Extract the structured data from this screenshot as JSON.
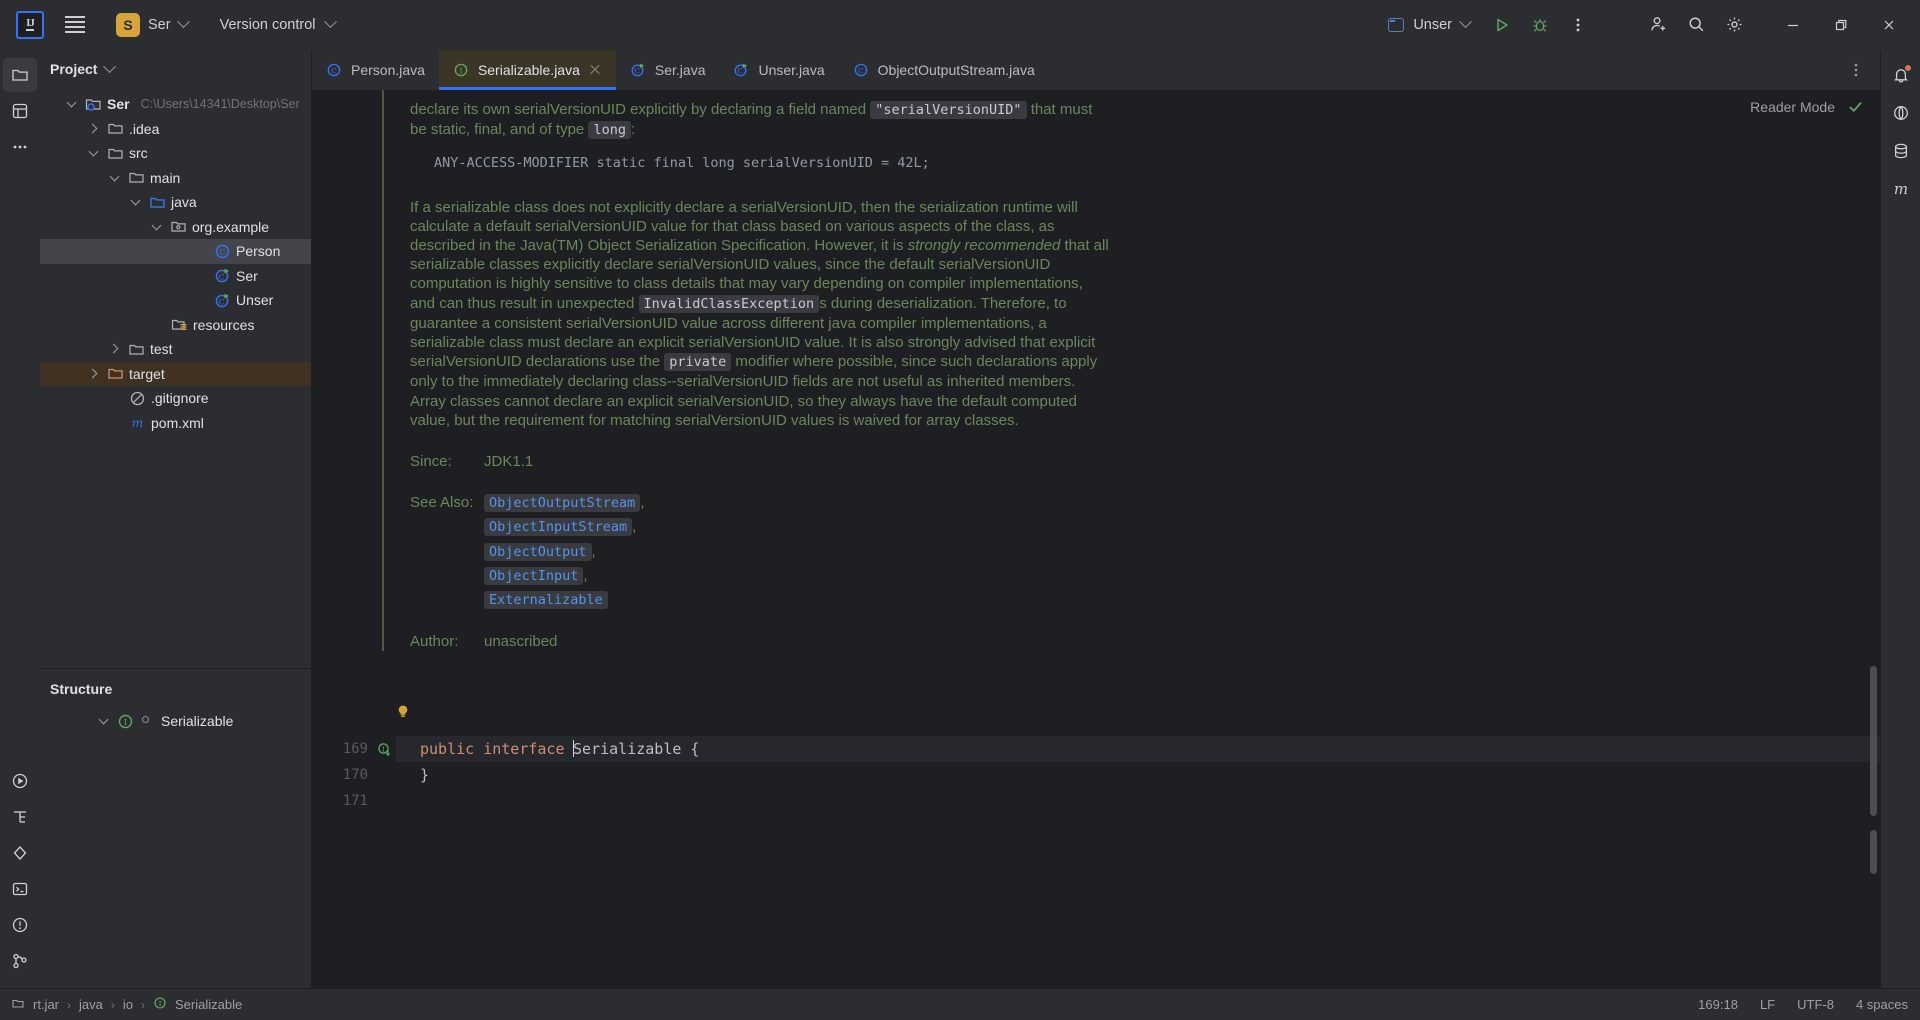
{
  "titlebar": {
    "logo_text": "IJ",
    "menu_icon": "hamburger-icon",
    "project_badge": "S",
    "project_name": "Ser",
    "vcs_label": "Version control",
    "run_config": "Unser",
    "run_icon": "run-icon",
    "debug_icon": "debug-icon",
    "more_icon": "more-vertical-icon",
    "add_user_icon": "add-user-icon",
    "search_icon": "search-icon",
    "settings_icon": "gear-icon",
    "minimize": "minimize-icon",
    "maximize": "restore-icon",
    "close": "close-icon"
  },
  "left_rail": {
    "items": [
      {
        "name": "project-tool-icon",
        "label": "Project"
      },
      {
        "name": "commit-tool-icon",
        "label": "Commit"
      },
      {
        "name": "more-tool-icon",
        "label": "More tool windows"
      }
    ],
    "bottom_items": [
      {
        "name": "run-tool-icon",
        "label": "Run"
      },
      {
        "name": "structure-tool-icon",
        "label": "Structure"
      },
      {
        "name": "services-tool-icon",
        "label": "Services"
      },
      {
        "name": "terminal-tool-icon",
        "label": "Terminal"
      },
      {
        "name": "problems-tool-icon",
        "label": "Problems"
      },
      {
        "name": "version-control-tool-icon",
        "label": "Version Control"
      }
    ]
  },
  "right_rail": {
    "items": [
      {
        "name": "notifications-icon",
        "label": "Notifications"
      },
      {
        "name": "ai-assistant-icon",
        "label": "AI Assistant"
      },
      {
        "name": "database-icon",
        "label": "Database"
      },
      {
        "name": "maven-icon",
        "label": "Maven"
      }
    ]
  },
  "project_panel": {
    "title": "Project",
    "chevron": "chevron-down-icon",
    "tree": [
      {
        "label": "Ser",
        "hint": "C:\\Users\\14341\\Desktop\\Ser",
        "depth": 0,
        "arrow": "open",
        "icon": "module-folder-icon",
        "bold": true,
        "state": "normal"
      },
      {
        "label": ".idea",
        "hint": "",
        "depth": 1,
        "arrow": "closed",
        "icon": "folder-icon",
        "bold": false,
        "state": "normal"
      },
      {
        "label": "src",
        "hint": "",
        "depth": 1,
        "arrow": "open",
        "icon": "folder-icon",
        "bold": false,
        "state": "normal"
      },
      {
        "label": "main",
        "hint": "",
        "depth": 2,
        "arrow": "open",
        "icon": "folder-icon",
        "bold": false,
        "state": "normal"
      },
      {
        "label": "java",
        "hint": "",
        "depth": 3,
        "arrow": "open",
        "icon": "source-folder-icon",
        "bold": false,
        "state": "normal"
      },
      {
        "label": "org.example",
        "hint": "",
        "depth": 4,
        "arrow": "open",
        "icon": "package-icon",
        "bold": false,
        "state": "normal"
      },
      {
        "label": "Person",
        "hint": "",
        "depth": 5,
        "arrow": "none",
        "icon": "java-class-icon",
        "bold": false,
        "state": "selected"
      },
      {
        "label": "Ser",
        "hint": "",
        "depth": 5,
        "arrow": "none",
        "icon": "java-runnable-class-icon",
        "bold": false,
        "state": "normal"
      },
      {
        "label": "Unser",
        "hint": "",
        "depth": 5,
        "arrow": "none",
        "icon": "java-runnable-class-icon",
        "bold": false,
        "state": "normal"
      },
      {
        "label": "resources",
        "hint": "",
        "depth": 4,
        "arrow": "none",
        "icon": "resources-folder-icon",
        "bold": false,
        "state": "normal"
      },
      {
        "label": "test",
        "hint": "",
        "depth": 3,
        "arrow": "closed",
        "icon": "folder-icon",
        "bold": false,
        "state": "normal"
      },
      {
        "label": "target",
        "hint": "",
        "depth": 2,
        "arrow": "closed",
        "icon": "excluded-folder-icon",
        "bold": false,
        "state": "excluded"
      },
      {
        "label": ".gitignore",
        "hint": "",
        "depth": 3,
        "arrow": "none",
        "icon": "gitignore-icon",
        "bold": false,
        "state": "normal"
      },
      {
        "label": "pom.xml",
        "hint": "",
        "depth": 3,
        "arrow": "none",
        "icon": "maven-pom-icon",
        "bold": false,
        "state": "normal"
      }
    ]
  },
  "structure_panel": {
    "title": "Structure",
    "items": [
      {
        "label": "Serializable",
        "arrow": "open",
        "icon": "java-interface-icon"
      }
    ]
  },
  "tabs": [
    {
      "label": "Person.java",
      "icon": "java-class-icon",
      "active": false,
      "closable": false
    },
    {
      "label": "Serializable.java",
      "icon": "java-interface-icon",
      "active": true,
      "closable": true
    },
    {
      "label": "Ser.java",
      "icon": "java-runnable-class-icon",
      "active": false,
      "closable": false
    },
    {
      "label": "Unser.java",
      "icon": "java-runnable-class-icon",
      "active": false,
      "closable": false
    },
    {
      "label": "ObjectOutputStream.java",
      "icon": "java-class-icon",
      "active": false,
      "closable": false
    }
  ],
  "tabs_more_icon": "more-vertical-icon",
  "editor": {
    "reader_mode_label": "Reader Mode",
    "reader_mode_check": "check-icon",
    "doc": {
      "para1_a": "declare its own serialVersionUID explicitly by declaring a field named ",
      "para1_chip": "\"serialVersionUID\"",
      "para1_b": " that must",
      "para2_a": "be static, final, and of type ",
      "para2_chip": "long",
      "para2_b": ":",
      "code_example": "ANY-ACCESS-MODIFIER static final long serialVersionUID = 42L;",
      "body_1": "If a serializable class does not explicitly declare a serialVersionUID, then the serialization runtime will",
      "body_2": "calculate a default serialVersionUID value for that class based on various aspects of the class, as",
      "body_3_a": "described in the Java(TM) Object Serialization Specification. However, it is ",
      "body_3_em": "strongly recommended",
      "body_3_b": " that all",
      "body_4": "serializable classes explicitly declare serialVersionUID values, since the default serialVersionUID",
      "body_5": "computation is highly sensitive to class details that may vary depending on compiler implementations,",
      "body_6_a": "and can thus result in unexpected ",
      "body_6_chip": "InvalidClassException",
      "body_6_b": "s during deserialization. Therefore, to",
      "body_7": "guarantee a consistent serialVersionUID value across different java compiler implementations, a",
      "body_8": "serializable class must declare an explicit serialVersionUID value. It is also strongly advised that explicit",
      "body_9_a": "serialVersionUID declarations use the ",
      "body_9_chip": "private",
      "body_9_b": " modifier where possible, since such declarations apply",
      "body_10": "only to the immediately declaring class--serialVersionUID fields are not useful as inherited members.",
      "body_11": "Array classes cannot declare an explicit serialVersionUID, so they always have the default computed",
      "body_12": "value, but the requirement for matching serialVersionUID values is waived for array classes.",
      "since_label": "Since:",
      "since_value": "JDK1.1",
      "seealso_label": "See Also:",
      "seealso_items": [
        {
          "text": "ObjectOutputStream",
          "comma": ","
        },
        {
          "text": "ObjectInputStream",
          "comma": ","
        },
        {
          "text": "ObjectOutput",
          "comma": ","
        },
        {
          "text": "ObjectInput",
          "comma": ","
        },
        {
          "text": "Externalizable",
          "comma": ""
        }
      ],
      "author_label": "Author:",
      "author_value": "unascribed"
    },
    "code_lines": [
      {
        "number": "169",
        "keyword": "public interface ",
        "name": "Serializable",
        "tail": " {",
        "current": true,
        "gutter_icon": "interface-implemented-icon",
        "bulb": true
      },
      {
        "number": "170",
        "keyword": "",
        "name": "",
        "tail": "}",
        "current": false,
        "gutter_icon": "",
        "bulb": false
      },
      {
        "number": "171",
        "keyword": "",
        "name": "",
        "tail": "",
        "current": false,
        "gutter_icon": "",
        "bulb": false
      }
    ]
  },
  "statusbar": {
    "breadcrumb": [
      {
        "label": "rt.jar",
        "icon": "jar-icon"
      },
      {
        "label": "java",
        "icon": ""
      },
      {
        "label": "io",
        "icon": ""
      },
      {
        "label": "Serializable",
        "icon": "java-interface-icon"
      }
    ],
    "caret_position": "169:18",
    "line_separator": "LF",
    "encoding": "UTF-8",
    "indent": "4 spaces"
  },
  "colors": {
    "accent_blue": "#3574f0",
    "doc_green": "#6a8759",
    "link_blue": "#5394ec",
    "keyword_orange": "#cf8e6d",
    "badge_gold": "#d6a53a",
    "excluded_bg": "#3f3222",
    "active_tab_bg": "#3b3526"
  }
}
